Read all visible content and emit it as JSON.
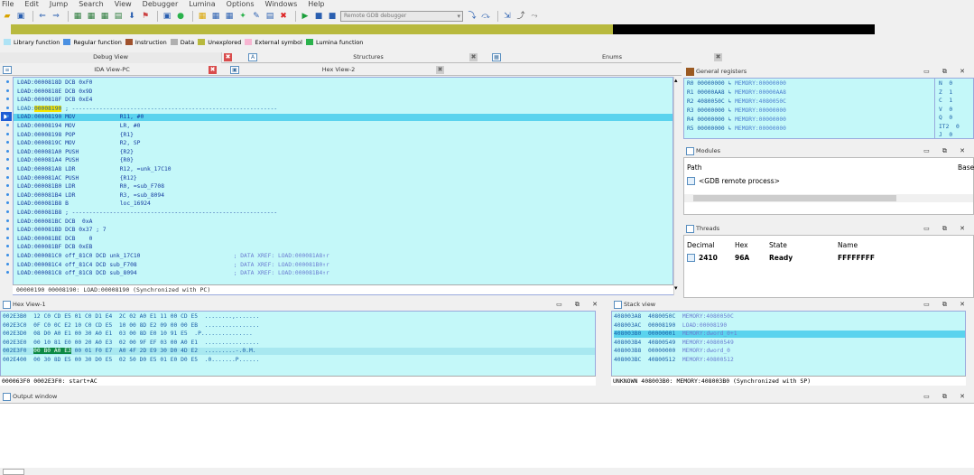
{
  "menu": [
    "File",
    "Edit",
    "Jump",
    "Search",
    "View",
    "Debugger",
    "Lumina",
    "Options",
    "Windows",
    "Help"
  ],
  "toolbar": {
    "debugger_select": "Remote GDB debugger"
  },
  "legend": [
    {
      "label": "Library function",
      "color": "#aee3f5"
    },
    {
      "label": "Regular function",
      "color": "#4a90e2"
    },
    {
      "label": "Instruction",
      "color": "#a0522d"
    },
    {
      "label": "Data",
      "color": "#b0b0b0"
    },
    {
      "label": "Unexplored",
      "color": "#b8b93e"
    },
    {
      "label": "External symbol",
      "color": "#f7b6d2"
    },
    {
      "label": "Lumina function",
      "color": "#2bb24c"
    }
  ],
  "tabs": {
    "debug_view": "Debug View",
    "structures": "Structures",
    "enums": "Enums",
    "ida_view": "IDA View-PC",
    "hex_view_2": "Hex View-2"
  },
  "disasm": {
    "lines": [
      {
        "text": "LOAD:0000818D DCB 0xF0"
      },
      {
        "text": "LOAD:0000818E DCB 0x9D"
      },
      {
        "text": "LOAD:0000818F DCB 0xE4"
      },
      {
        "pre": "LOAD:",
        "hl_addr": "00008190",
        "post": " ; ------------------------------------------------------------"
      },
      {
        "text": "LOAD:00008190 MOV             R11, #0",
        "current": true
      },
      {
        "text": "LOAD:00008194 MOV             LR, #0"
      },
      {
        "text": "LOAD:00008198 POP             {R1}"
      },
      {
        "text": "LOAD:0000819C MOV             R2, SP"
      },
      {
        "text": "LOAD:000081A0 PUSH            {R2}"
      },
      {
        "text": "LOAD:000081A4 PUSH            {R0}"
      },
      {
        "text": "LOAD:000081A8 LDR             R12, =unk_17C10"
      },
      {
        "text": "LOAD:000081AC PUSH            {R12}"
      },
      {
        "text": "LOAD:000081B0 LDR             R0, =sub_F708"
      },
      {
        "text": "LOAD:000081B4 LDR             R3, =sub_8094"
      },
      {
        "text": "LOAD:000081B8 B               loc_16924"
      },
      {
        "text": "LOAD:000081B8 ; ------------------------------------------------------------"
      },
      {
        "text": "LOAD:000081BC DCB  0xA"
      },
      {
        "text": "LOAD:000081BD DCB 0x37 ; 7"
      },
      {
        "text": "LOAD:000081BE DCB    0"
      },
      {
        "text": "LOAD:000081BF DCB 0xEB"
      },
      {
        "text": "LOAD:000081C0 off_81C0 DCD unk_17C10",
        "comment": "; DATA XREF: LOAD:000081A8↑r"
      },
      {
        "text": "LOAD:000081C4 off_81C4 DCD sub_F708",
        "comment": "; DATA XREF: LOAD:000081B0↑r"
      },
      {
        "text": "LOAD:000081C8 off_81C8 DCD sub_8094",
        "comment": "; DATA XREF: LOAD:000081B4↑r"
      }
    ],
    "status": "00000190 00008190: LOAD:00008190 (Synchronized with PC)"
  },
  "registers": {
    "title": "General registers",
    "rows": [
      {
        "name": "R0",
        "value": "00000000",
        "ref": "MEMORY:00000000"
      },
      {
        "name": "R1",
        "value": "00000AA8",
        "ref": "MEMORY:00000AA8"
      },
      {
        "name": "R2",
        "value": "4080050C",
        "ref": "MEMORY:4080050C"
      },
      {
        "name": "R3",
        "value": "00000000",
        "ref": "MEMORY:00000000"
      },
      {
        "name": "R4",
        "value": "00000000",
        "ref": "MEMORY:00000000"
      },
      {
        "name": "R5",
        "value": "00000000",
        "ref": "MEMORY:00000000"
      }
    ],
    "flags": [
      {
        "name": "N",
        "value": "0"
      },
      {
        "name": "Z",
        "value": "1"
      },
      {
        "name": "C",
        "value": "1"
      },
      {
        "name": "V",
        "value": "0"
      },
      {
        "name": "Q",
        "value": "0"
      },
      {
        "name": "IT2",
        "value": "0"
      },
      {
        "name": "J",
        "value": "0"
      }
    ]
  },
  "modules": {
    "title": "Modules",
    "col_path": "Path",
    "col_base": "Base",
    "row": "<GDB remote process>"
  },
  "threads": {
    "title": "Threads",
    "cols": [
      "Decimal",
      "Hex",
      "State",
      "Name"
    ],
    "row": {
      "decimal": "2410",
      "hex": "96A",
      "state": "Ready",
      "name": "FFFFFFFF"
    }
  },
  "hex1": {
    "title": "Hex View-1",
    "rows": [
      {
        "text": "002E3B0  12 C0 CD E5 01 C0 D1 E4  2C 02 A0 E1 11 00 CD E5  ........,......."
      },
      {
        "text": "002E3C0  0F C0 0C E2 10 C0 CD E5  10 00 8D E2 09 00 00 EB  ................"
      },
      {
        "text": "002E3D0  08 D0 A0 E1 00 30 A0 E1  03 00 8D E0 10 91 E5  .P..............."
      },
      {
        "text": "002E3E0  00 10 81 E0 00 20 A0 E3  02 00 9F EF 03 00 A0 E1  ................"
      },
      {
        "pre": "002E3F0  ",
        "sel": "00 B0 A0 E3",
        "post": " 00 01 F0 E7  A0 4F 2D E9 30 D0 4D E2  .........-.0.M.",
        "highlight": true
      },
      {
        "text": "002E400  00 30 8D E5 00 30 D0 E5  02 50 D0 E5 01 E0 D0 E5  .0.......P......"
      }
    ],
    "status": "000063F0 0002E3F0: start+AC"
  },
  "stack": {
    "title": "Stack view",
    "rows": [
      {
        "addr": "408003A8",
        "value": "4080050C",
        "ref": "MEMORY:4080050C"
      },
      {
        "addr": "408003AC",
        "value": "00008190",
        "ref": "LOAD:00008190"
      },
      {
        "addr": "408003B0",
        "value": "00000001",
        "ref": "MEMORY:dword_0+1",
        "highlight": true
      },
      {
        "addr": "408003B4",
        "value": "40800549",
        "ref": "MEMORY:40800549"
      },
      {
        "addr": "408003B8",
        "value": "00000000",
        "ref": "MEMORY:dword_0"
      },
      {
        "addr": "408003BC",
        "value": "40800512",
        "ref": "MEMORY:40800512"
      }
    ],
    "status": "UNKNOWN 408003B0: MEMORY:408003B0 (Synchronized with SP)"
  },
  "output": {
    "title": "Output window"
  }
}
